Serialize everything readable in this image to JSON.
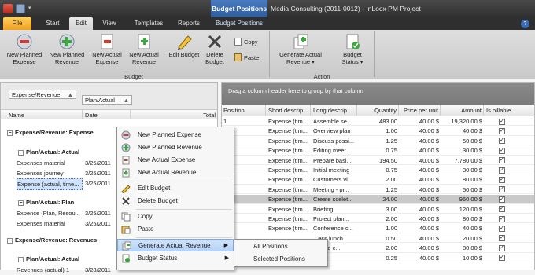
{
  "title_bar": {
    "contextual_tab_group": "Budget Positions",
    "window_title": "Media Consulting (2011-0012) - InLoox PM Project"
  },
  "tabs": [
    "File",
    "Start",
    "Edit",
    "View",
    "Templates",
    "Reports",
    "Budget Positions"
  ],
  "ribbon": {
    "budget_group": {
      "label": "Budget",
      "buttons": [
        "New Planned Expense",
        "New Planned Revenue",
        "New Actual Expense",
        "New Actual Revenue",
        "Edit Budget",
        "Delete Budget"
      ],
      "small_buttons": [
        "Copy",
        "Paste"
      ]
    },
    "action_group": {
      "label": "Action",
      "buttons": [
        "Generate Actual Revenue",
        "Budget Status"
      ]
    }
  },
  "left_panel": {
    "group_chips": [
      "Expense/Revenue",
      "Plan/Actual"
    ],
    "columns": [
      "Name",
      "Date",
      "Total"
    ],
    "rows": [
      {
        "kind": "group1",
        "text": "Expense/Revenue: Expense"
      },
      {
        "kind": "group2",
        "text": "Plan/Actual: Actual"
      },
      {
        "kind": "item",
        "name": "Expenses material",
        "date": "3/25/2011"
      },
      {
        "kind": "item",
        "name": "Expenses journey",
        "date": "3/25/2011"
      },
      {
        "kind": "item",
        "name": "Expense (actual, time...",
        "date": "3/25/2011",
        "selected": true
      },
      {
        "kind": "group2",
        "text": "Plan/Actual: Plan"
      },
      {
        "kind": "item",
        "name": "Expence (Plan, Resou...",
        "date": "3/25/2011"
      },
      {
        "kind": "item",
        "name": "Expenses material",
        "date": "3/25/2011"
      },
      {
        "kind": "group1",
        "text": "Expense/Revenue: Revenues"
      },
      {
        "kind": "group2",
        "text": "Plan/Actual: Actual"
      },
      {
        "kind": "item",
        "name": "Revenues (actual) 1",
        "date": "3/28/2011"
      }
    ]
  },
  "right_panel": {
    "group_hint": "Drag a column header here to group by that column",
    "columns": [
      "Position",
      "Short descrip...",
      "Long descrip...",
      "Quantity",
      "Price per unit",
      "Amount",
      "Is billable"
    ],
    "rows": [
      {
        "pos": "1",
        "short": "Expense (tim...",
        "long": "Assemble se...",
        "qty": "483.00",
        "price": "40.00 $",
        "amount": "19,320.00 $"
      },
      {
        "pos": "",
        "short": "Expense (tim...",
        "long": "Overview plan",
        "qty": "1.00",
        "price": "40.00 $",
        "amount": "40.00 $"
      },
      {
        "pos": "",
        "short": "Expense (tim...",
        "long": "Discuss possi...",
        "qty": "1.25",
        "price": "40.00 $",
        "amount": "50.00 $"
      },
      {
        "pos": "",
        "short": "Expense (tim...",
        "long": "Editing meet...",
        "qty": "0.75",
        "price": "40.00 $",
        "amount": "30.00 $"
      },
      {
        "pos": "",
        "short": "Expense (tim...",
        "long": "Prepare basi...",
        "qty": "194.50",
        "price": "40.00 $",
        "amount": "7,780.00 $"
      },
      {
        "pos": "",
        "short": "Expense (tim...",
        "long": "Initial meeting",
        "qty": "0.75",
        "price": "40.00 $",
        "amount": "30.00 $"
      },
      {
        "pos": "",
        "short": "Expense (tim...",
        "long": "Customers vi...",
        "qty": "2.00",
        "price": "40.00 $",
        "amount": "80.00 $"
      },
      {
        "pos": "",
        "short": "Expense (tim...",
        "long": "Meeting - pr...",
        "qty": "1.25",
        "price": "40.00 $",
        "amount": "50.00 $"
      },
      {
        "pos": "",
        "short": "Expense (tim...",
        "long": "Create scelet...",
        "qty": "24.00",
        "price": "40.00 $",
        "amount": "960.00 $",
        "selected": true
      },
      {
        "pos": "",
        "short": "Expense (tim...",
        "long": "Briefing",
        "qty": "3.00",
        "price": "40.00 $",
        "amount": "120.00 $"
      },
      {
        "pos": "",
        "short": "Expense (tim...",
        "long": "Project plan...",
        "qty": "2.00",
        "price": "40.00 $",
        "amount": "80.00 $"
      },
      {
        "pos": "",
        "short": "Expense (tim...",
        "long": "Conference c...",
        "qty": "1.00",
        "price": "40.00 $",
        "amount": "40.00 $"
      },
      {
        "pos": "",
        "short": "",
        "long": "...ess lunch",
        "qty": "0.50",
        "price": "40.00 $",
        "amount": "20.00 $"
      },
      {
        "pos": "",
        "short": "",
        "long": "...ence c...",
        "qty": "2.00",
        "price": "40.00 $",
        "amount": "80.00 $"
      },
      {
        "pos": "",
        "short": "",
        "long": "...012",
        "qty": "0.25",
        "price": "40.00 $",
        "amount": "10.00 $"
      }
    ]
  },
  "context_menu": {
    "items": [
      "New Planned Expense",
      "New Planned Revenue",
      "New Actual Expense",
      "New Actual Revenue",
      "Edit Budget",
      "Delete Budget",
      "Copy",
      "Paste",
      "Generate Actual Revenue",
      "Budget Status"
    ],
    "highlighted": "Generate Actual Revenue"
  },
  "submenu": {
    "items": [
      "All Positions",
      "Selected Positions"
    ]
  },
  "colors": {
    "accent": "#2e5d9e",
    "file_tab": "#f0a020",
    "ribbon_bg": "#d4d4d4",
    "selection": "#c9c9c9",
    "menu_highlight": "#cfe2fb"
  }
}
